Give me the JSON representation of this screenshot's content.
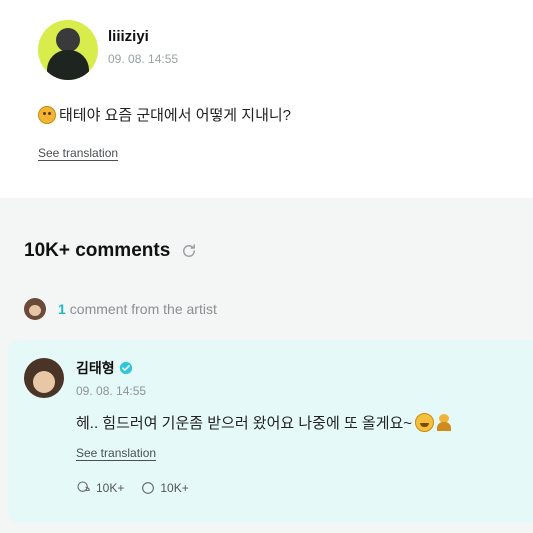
{
  "post": {
    "author": "liiiziyi",
    "timestamp": "09. 08. 14:55",
    "text": "태테야 요즘 군대에서 어떻게 지내니?",
    "translate_label": "See translation"
  },
  "comments": {
    "title": "10K+ comments",
    "artist_count": "1",
    "artist_label": "comment from the artist"
  },
  "artist_comment": {
    "author": "김태형",
    "timestamp": "09. 08. 14:55",
    "text": "헤.. 힘드러여 기운좀 받으러 왔어요 나중에 또 올게요~",
    "translate_label": "See translation",
    "replies_count": "10K+",
    "likes_count": "10K+"
  },
  "colors": {
    "accent": "#22b8c8",
    "comment_bg": "#e6f9f9",
    "verified": "#2fc6d6"
  }
}
